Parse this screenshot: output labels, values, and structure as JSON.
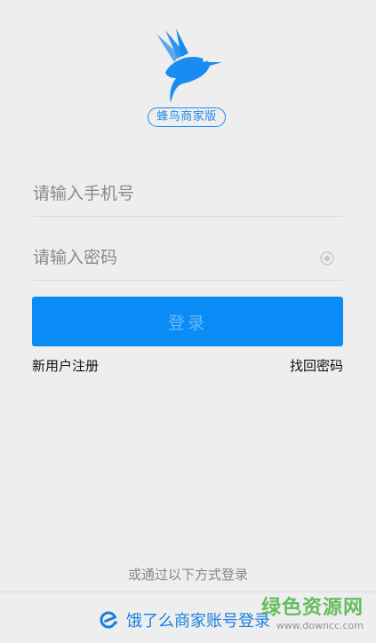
{
  "brand": {
    "name": "蜂鸟商家版",
    "logo_icon": "hummingbird-logo-icon",
    "accent_color": "#1a8bf0"
  },
  "form": {
    "phone_placeholder": "请输入手机号",
    "password_placeholder": "请输入密码",
    "password_toggle_icon": "eye-icon",
    "login_button_label": "登录"
  },
  "links": {
    "register": "新用户注册",
    "forgot_password": "找回密码"
  },
  "alternate": {
    "label": "或通过以下方式登录",
    "eleme_login_label": "饿了么商家账号登录",
    "eleme_icon": "eleme-logo-icon"
  },
  "watermark": {
    "text": "绿色资源网",
    "url": "www.downcc.com"
  }
}
